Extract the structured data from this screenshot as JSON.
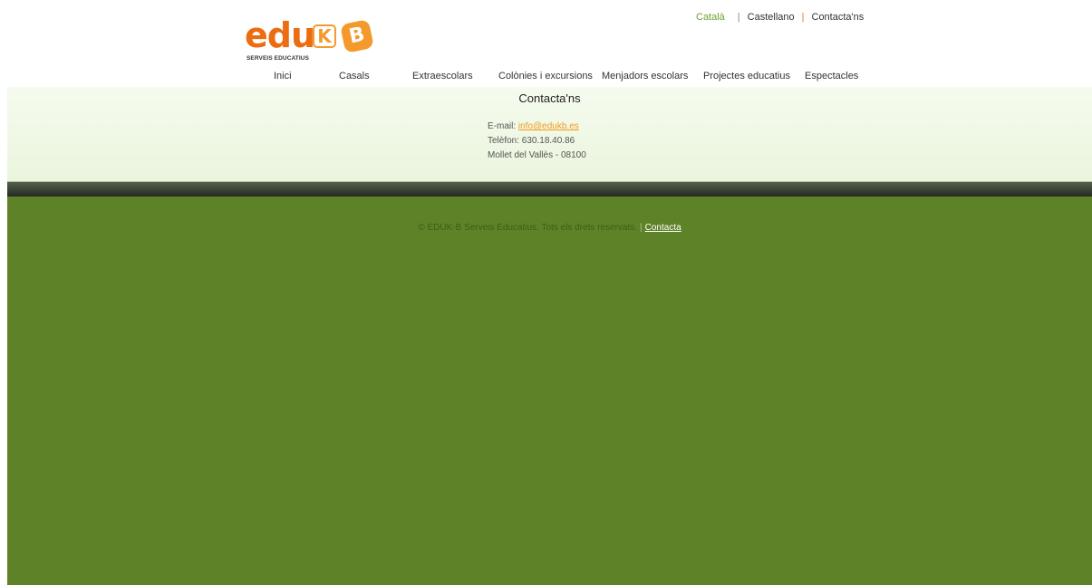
{
  "logo": {
    "word": "edu",
    "k": "K",
    "b": "B",
    "tagline": "SERVEIS EDUCATIUS"
  },
  "langbar": {
    "catala": "Català",
    "castellano": "Castellano",
    "contacta": "Contacta'ns",
    "sep": "|"
  },
  "nav": [
    "Inici",
    "Casals",
    "Extraescolars",
    "Colònies i excursions",
    "Menjadors escolars",
    "Projectes educatius",
    "Espectacles"
  ],
  "contact": {
    "title": "Contacta'ns",
    "email_label": "E-mail: ",
    "email": "info@edukb.es",
    "phone": "Telèfon: 630.18.40.86",
    "address": "Mollet del Vallès - 08100"
  },
  "footer": {
    "copyright": "© EDUK-B Serveis Educatius. Tots els drets reservats.",
    "pipe": "|",
    "link": "Contacta"
  },
  "colors": {
    "brand_orange": "#ec6c12",
    "logo_orange": "#f49a2c",
    "active_green": "#6aa232",
    "footer_green": "#5e8228"
  }
}
